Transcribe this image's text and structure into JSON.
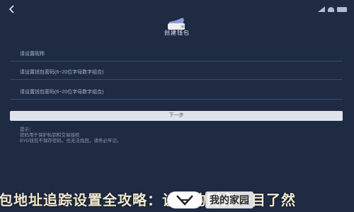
{
  "header": {
    "title": "创建钱包"
  },
  "form": {
    "fields": [
      {
        "placeholder": "请设置昵称"
      },
      {
        "placeholder": "请设置钱包密码(6~20位字母数字组合)"
      },
      {
        "placeholder": "请设置钱包密码(6~20位字母数字组合)"
      }
    ],
    "next_label": "下一步"
  },
  "notice": {
    "lines": [
      "提示：",
      "密码用于保护私钥和交易授权",
      "BYD钱包不保存密码，也无法找回，请务必牢记。"
    ]
  },
  "banner": {
    "text": "包地址追踪设置全攻略：让您的财务一目了然"
  },
  "watermark": {
    "text": "我的家园"
  },
  "colors": {
    "background": "#1e2b43",
    "button": "#dfe3ea"
  }
}
